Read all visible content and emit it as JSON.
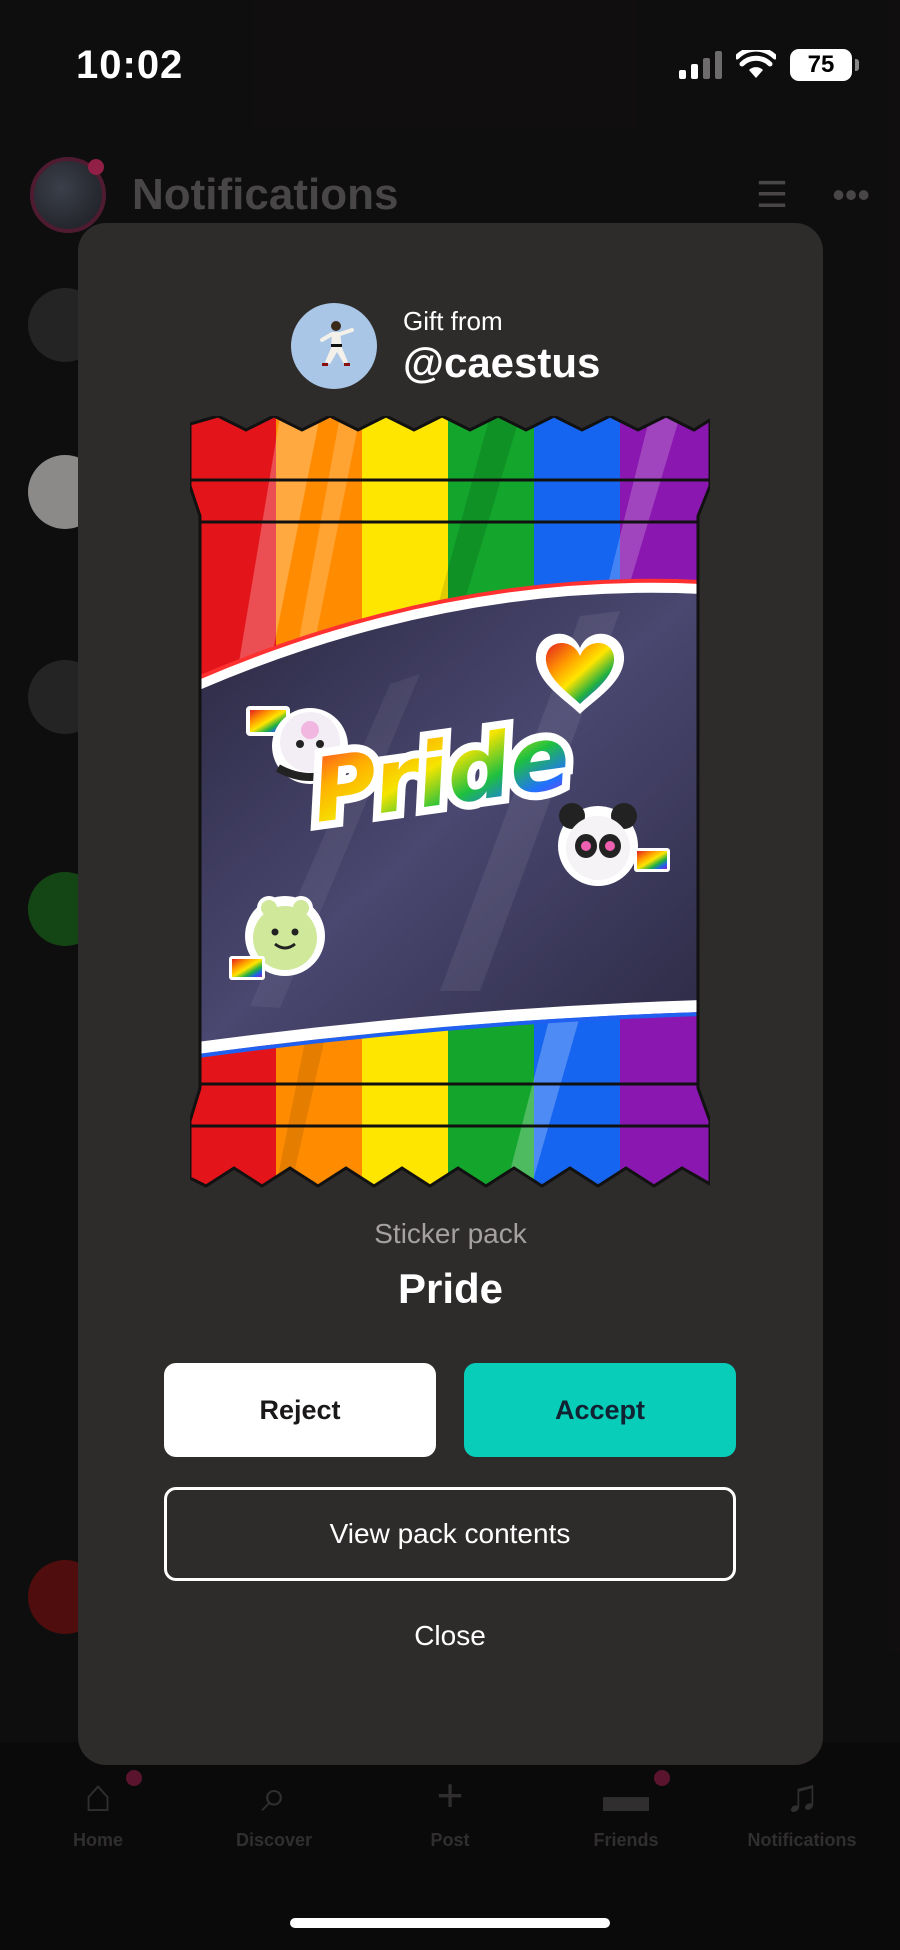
{
  "status_bar": {
    "time": "10:02",
    "battery": "75"
  },
  "background": {
    "header_title": "Notifications",
    "nav": [
      {
        "label": "Home",
        "icon": "home-icon"
      },
      {
        "label": "Discover",
        "icon": "search-icon"
      },
      {
        "label": "Post",
        "icon": "plus-icon"
      },
      {
        "label": "Friends",
        "icon": "chat-icon"
      },
      {
        "label": "Notifications",
        "icon": "bell-icon"
      }
    ]
  },
  "gift": {
    "from_label": "Gift from",
    "username": "@caestus"
  },
  "pack": {
    "type": "Sticker pack",
    "name": "Pride",
    "art_text": "Pride"
  },
  "actions": {
    "reject": "Reject",
    "accept": "Accept",
    "view_contents": "View pack contents",
    "close": "Close"
  },
  "colors": {
    "modal_bg": "#2e2b2b",
    "accept": "#07cdb9",
    "rainbow": [
      "#e4141b",
      "#ff8c00",
      "#ffe600",
      "#13a52c",
      "#1565f0",
      "#8a17b0"
    ]
  }
}
